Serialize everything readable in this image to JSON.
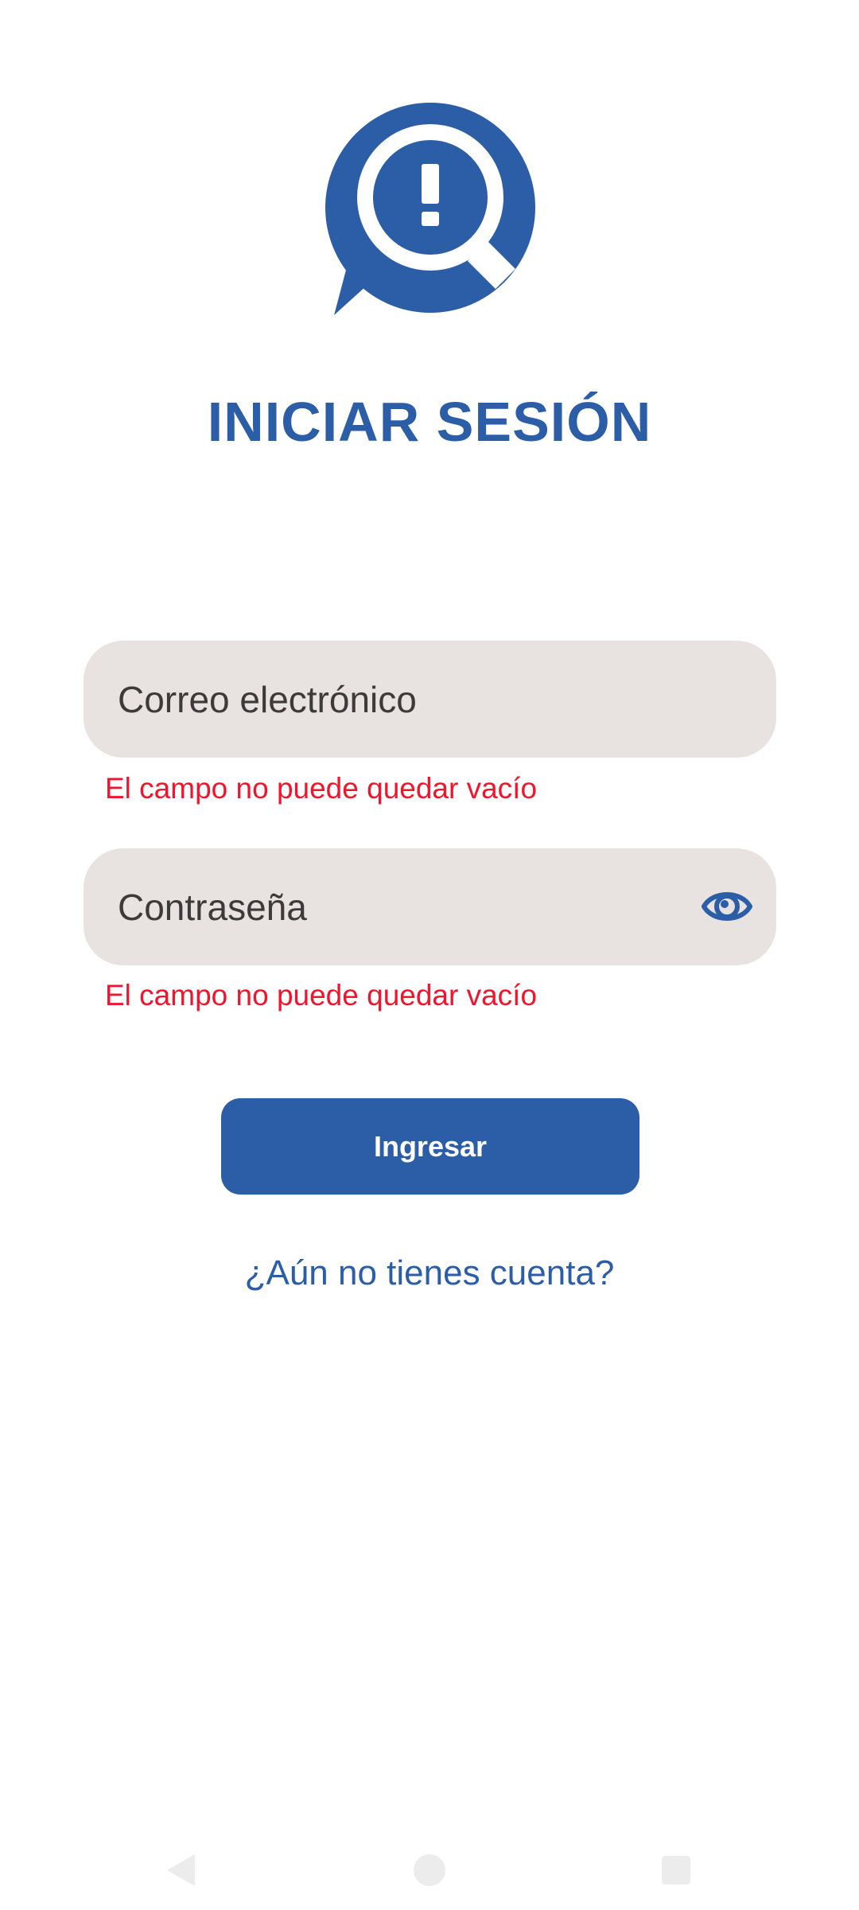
{
  "app": {
    "logo_icon": "speech-bubble-magnifier-exclamation-icon",
    "accent_color": "#2c5ea8"
  },
  "login": {
    "title": "INICIAR SESIÓN",
    "email": {
      "placeholder": "Correo electrónico",
      "value": "",
      "error": "El campo no puede quedar vacío"
    },
    "password": {
      "placeholder": "Contraseña",
      "value": "",
      "error": "El campo no puede quedar vacío",
      "toggle_icon": "eye-icon"
    },
    "submit_label": "Ingresar",
    "register_link": "¿Aún no tienes cuenta?"
  },
  "colors": {
    "error": "#f2142c",
    "field_bg": "#e8e2e1"
  },
  "system_nav": {
    "back_icon": "back-triangle-icon",
    "home_icon": "home-circle-icon",
    "recents_icon": "recents-square-icon"
  }
}
